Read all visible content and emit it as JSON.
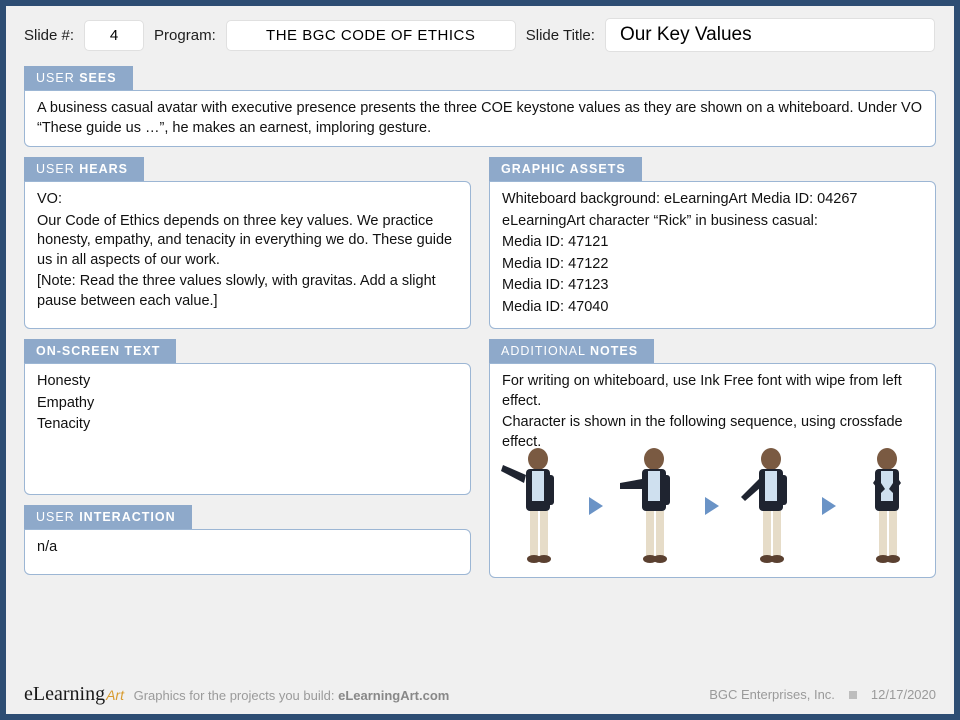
{
  "header": {
    "slide_label": "Slide #:",
    "slide_number": "4",
    "program_label": "Program:",
    "program": "THE BGC CODE OF ETHICS",
    "title_label": "Slide Title:",
    "title": "Our Key Values"
  },
  "sections": {
    "sees": {
      "tab_pre": "USER ",
      "tab_bold": "SEES",
      "body": "A business casual avatar with executive presence presents the three COE keystone values as they are shown on a whiteboard. Under VO “These guide us …”, he makes an earnest, imploring gesture."
    },
    "hears": {
      "tab_pre": "USER ",
      "tab_bold": "HEARS",
      "lines": [
        "VO:",
        "Our Code of Ethics depends on three key values. We practice honesty, empathy, and tenacity in everything we do. These guide us in all aspects of our work.",
        "",
        "[Note: Read the three values slowly, with gravitas. Add a slight pause between each value.]"
      ]
    },
    "graphic": {
      "tab_pre": "",
      "tab_bold": "GRAPHIC ASSETS",
      "lines": [
        "Whiteboard background: eLearningArt Media ID: 04267",
        "eLearningArt character “Rick” in business casual:",
        "Media ID: 47121",
        "Media ID: 47122",
        "Media ID: 47123",
        "Media ID: 47040"
      ]
    },
    "onscreen": {
      "tab_pre": "",
      "tab_bold": "ON-SCREEN TEXT",
      "lines": [
        "Honesty",
        "Empathy",
        "Tenacity"
      ]
    },
    "notes": {
      "tab_pre": "ADDITIONAL ",
      "tab_bold": "NOTES",
      "lines": [
        "For writing on whiteboard, use Ink Free font with wipe from left effect.",
        "Character is shown in the following sequence, using crossfade effect."
      ]
    },
    "interaction": {
      "tab_pre": "USER ",
      "tab_bold": "INTERACTION",
      "body": "n/a"
    }
  },
  "footer": {
    "logo_main": "eLearning",
    "logo_accent": "Art",
    "tagline_pre": "Graphics for the projects you build: ",
    "tagline_bold": "eLearningArt.com",
    "company": "BGC Enterprises, Inc.",
    "date": "12/17/2020"
  }
}
